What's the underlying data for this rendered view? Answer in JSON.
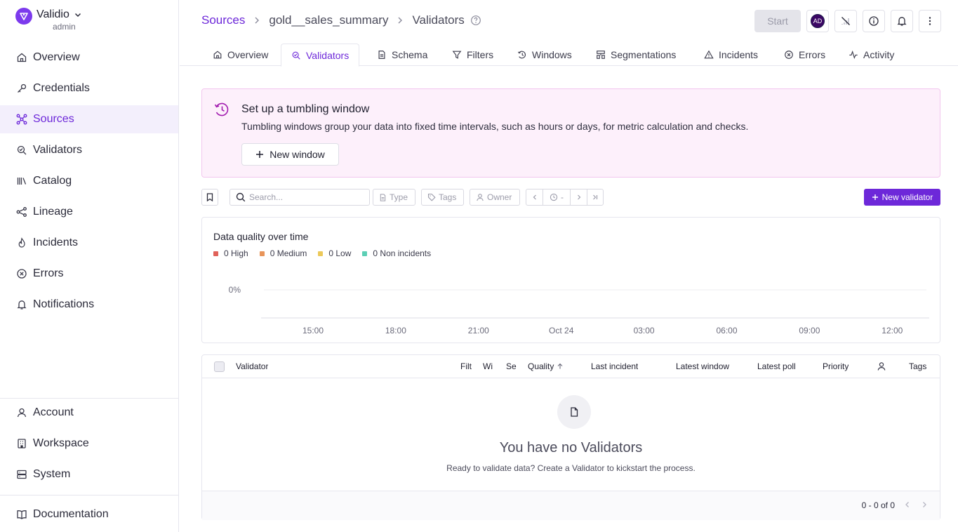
{
  "brand": {
    "name": "Validio",
    "role": "admin"
  },
  "sidebar": {
    "items": [
      {
        "label": "Overview",
        "icon": "home-icon"
      },
      {
        "label": "Credentials",
        "icon": "key-icon"
      },
      {
        "label": "Sources",
        "icon": "sources-icon",
        "active": true
      },
      {
        "label": "Validators",
        "icon": "validators-icon"
      },
      {
        "label": "Catalog",
        "icon": "catalog-icon"
      },
      {
        "label": "Lineage",
        "icon": "lineage-icon"
      },
      {
        "label": "Incidents",
        "icon": "flame-icon"
      },
      {
        "label": "Errors",
        "icon": "x-circle-icon"
      },
      {
        "label": "Notifications",
        "icon": "bell-icon"
      }
    ],
    "bottom": [
      {
        "label": "Account",
        "icon": "user-icon"
      },
      {
        "label": "Workspace",
        "icon": "building-icon"
      },
      {
        "label": "System",
        "icon": "server-icon"
      }
    ],
    "documentation": "Documentation"
  },
  "breadcrumb": {
    "sources": "Sources",
    "source": "gold__sales_summary",
    "page": "Validators"
  },
  "header": {
    "start_label": "Start",
    "avatar_initials": "AD"
  },
  "tabs": [
    {
      "label": "Overview",
      "icon": "home-icon"
    },
    {
      "label": "Validators",
      "icon": "validators-icon",
      "active": true
    },
    {
      "label": "Schema",
      "icon": "schema-icon"
    },
    {
      "label": "Filters",
      "icon": "filter-icon"
    },
    {
      "label": "Windows",
      "icon": "windows-icon"
    },
    {
      "label": "Segmentations",
      "icon": "segmentation-icon"
    },
    {
      "label": "Incidents",
      "icon": "warning-icon"
    },
    {
      "label": "Errors",
      "icon": "x-circle-icon"
    },
    {
      "label": "Activity",
      "icon": "activity-icon"
    }
  ],
  "banner": {
    "title": "Set up a tumbling window",
    "description": "Tumbling windows group your data into fixed time intervals, such as hours or days, for metric calculation and checks.",
    "button": "New window"
  },
  "toolbar": {
    "search_placeholder": "Search...",
    "type": "Type",
    "tags": "Tags",
    "owner": "Owner",
    "time": "-",
    "new_validator": "New validator"
  },
  "chart_data": {
    "type": "line",
    "title": "Data quality over time",
    "series": [],
    "legend": [
      {
        "label": "0 High",
        "color": "#e0625a"
      },
      {
        "label": "0 Medium",
        "color": "#e8955a"
      },
      {
        "label": "0 Low",
        "color": "#ecc95a"
      },
      {
        "label": "0 Non incidents",
        "color": "#5ccfb5"
      }
    ],
    "yticks": [
      "0%"
    ],
    "xticks": [
      "15:00",
      "18:00",
      "21:00",
      "Oct 24",
      "03:00",
      "06:00",
      "09:00",
      "12:00"
    ]
  },
  "table": {
    "columns": [
      "Validator",
      "Filt",
      "Wi",
      "Se",
      "Quality",
      "Last incident",
      "Latest window",
      "Latest poll",
      "Priority",
      "",
      "Tags"
    ],
    "empty_title": "You have no Validators",
    "empty_desc": "Ready to validate data? Create a Validator to kickstart the process.",
    "pagination": "0 - 0 of 0"
  }
}
